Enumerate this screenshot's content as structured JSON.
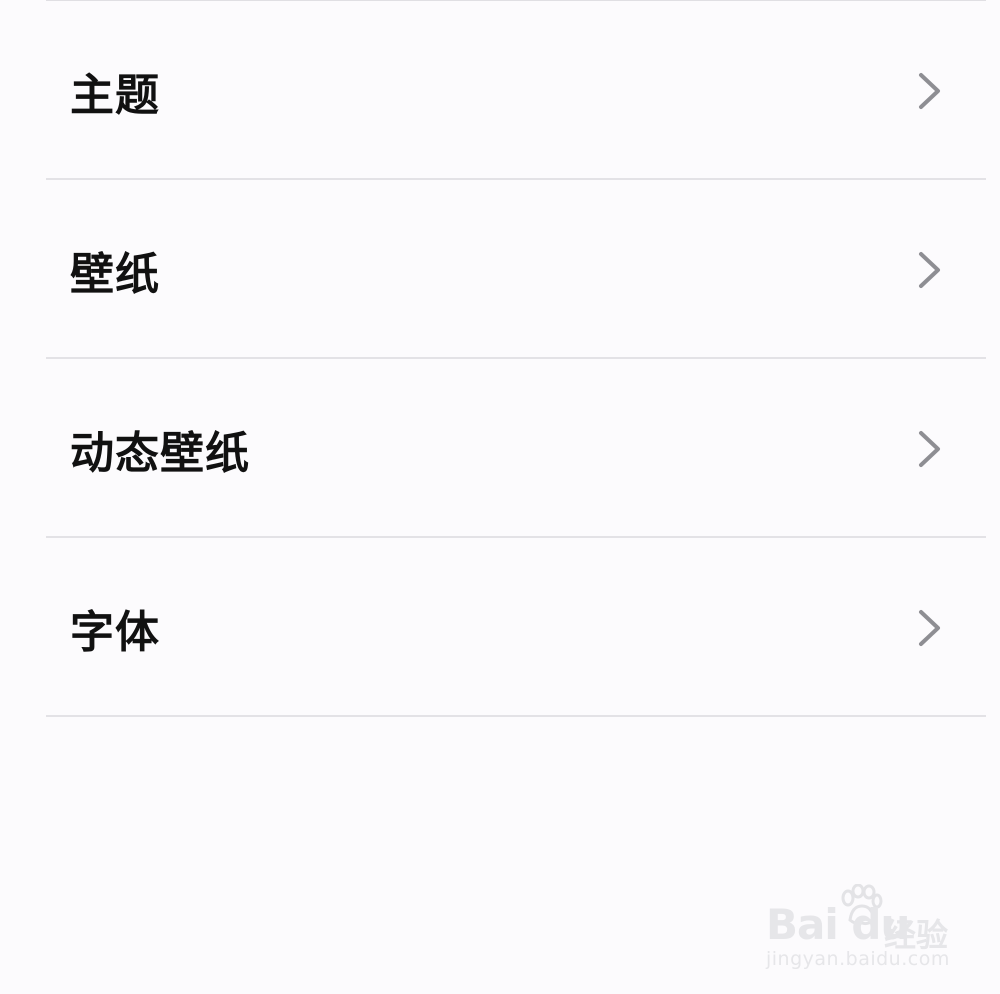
{
  "settings": {
    "items": [
      {
        "label": "主题",
        "icon": "chevron-right-icon"
      },
      {
        "label": "壁纸",
        "icon": "chevron-right-icon"
      },
      {
        "label": "动态壁纸",
        "icon": "chevron-right-icon"
      },
      {
        "label": "字体",
        "icon": "chevron-right-icon"
      }
    ]
  },
  "watermark": {
    "brand": "Bai du",
    "product": "经验",
    "url": "jingyan.baidu.com"
  },
  "colors": {
    "background": "#fcfbfd",
    "text": "#111111",
    "chevron": "#8e8e93",
    "divider": "#e3e2e6",
    "watermark": "#e6e6e9"
  }
}
